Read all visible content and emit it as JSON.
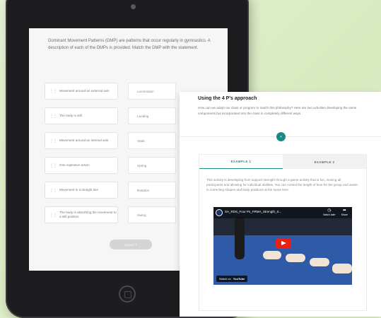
{
  "background": {
    "color": "#dfeec9"
  },
  "quiz": {
    "intro": "Dominant Movement Patterns (DMP) are patterns that occur regularly in gymnastics. A description of each of the DMPs is provided. Match the DMP with the statement.",
    "items": [
      {
        "statement": "Movement around an external axis",
        "target": "Locomotion"
      },
      {
        "statement": "The body is still",
        "target": "Landing"
      },
      {
        "statement": "Movement around an internal axis",
        "target": "Static"
      },
      {
        "statement": "One explosive action",
        "target": "Spring"
      },
      {
        "statement": "Movement in a straight line",
        "target": "Rotation"
      },
      {
        "statement": "The body is absorbing the movement to a still position",
        "target": "Swing"
      }
    ],
    "submit_label": "SUBMIT"
  },
  "panel": {
    "title": "Using the 4 P's approach",
    "subtitle": "How can we adapt our class or program to match this philosophy? Here are two activities developing the same components but incorporated into the class in completely different ways.",
    "step_icon": "plus",
    "tabs": [
      "EXAMPLE 1",
      "EXAMPLE 2"
    ],
    "description": "This activity is developing from support strength through a game activity that is fun, moving all participants and allowing for individual abilities. You can control the length of time for the group and assist in correcting shapes and body positions at the same time.",
    "accent": "#1a8b82",
    "video": {
      "title": "SA_RDS_Four Ps_FRMA_Strength_S...",
      "watch_later": "Watch later",
      "share": "Share",
      "watch_on": "Watch on",
      "platform": "YouTube"
    }
  }
}
